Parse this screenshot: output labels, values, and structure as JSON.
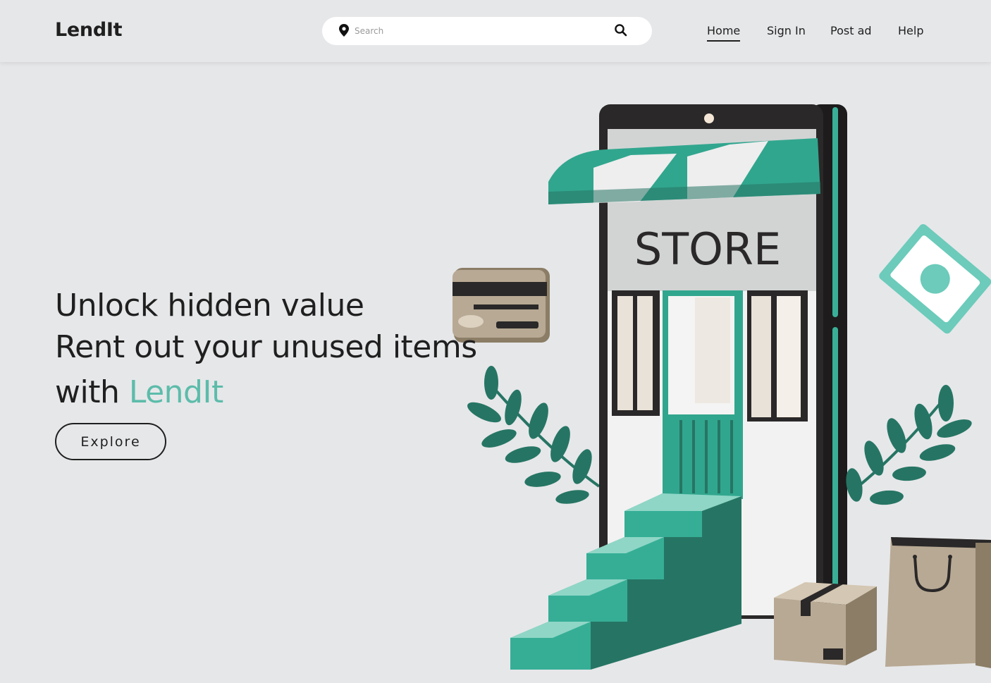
{
  "header": {
    "logo": "LendIt",
    "search": {
      "placeholder": "Search"
    },
    "nav": [
      {
        "label": "Home",
        "active": true
      },
      {
        "label": "Sign In"
      },
      {
        "label": "Post ad"
      },
      {
        "label": "Help"
      }
    ]
  },
  "hero": {
    "line1": "Unlock hidden value",
    "line2": "Rent out your unused items",
    "line3_prefix": "with ",
    "line3_brand": "LendIt",
    "cta": "Explore"
  },
  "illustration": {
    "store_sign": "STORE"
  },
  "colors": {
    "accent": "#5cbcaa",
    "teal_dark": "#267564",
    "background": "#e6e7e9"
  }
}
